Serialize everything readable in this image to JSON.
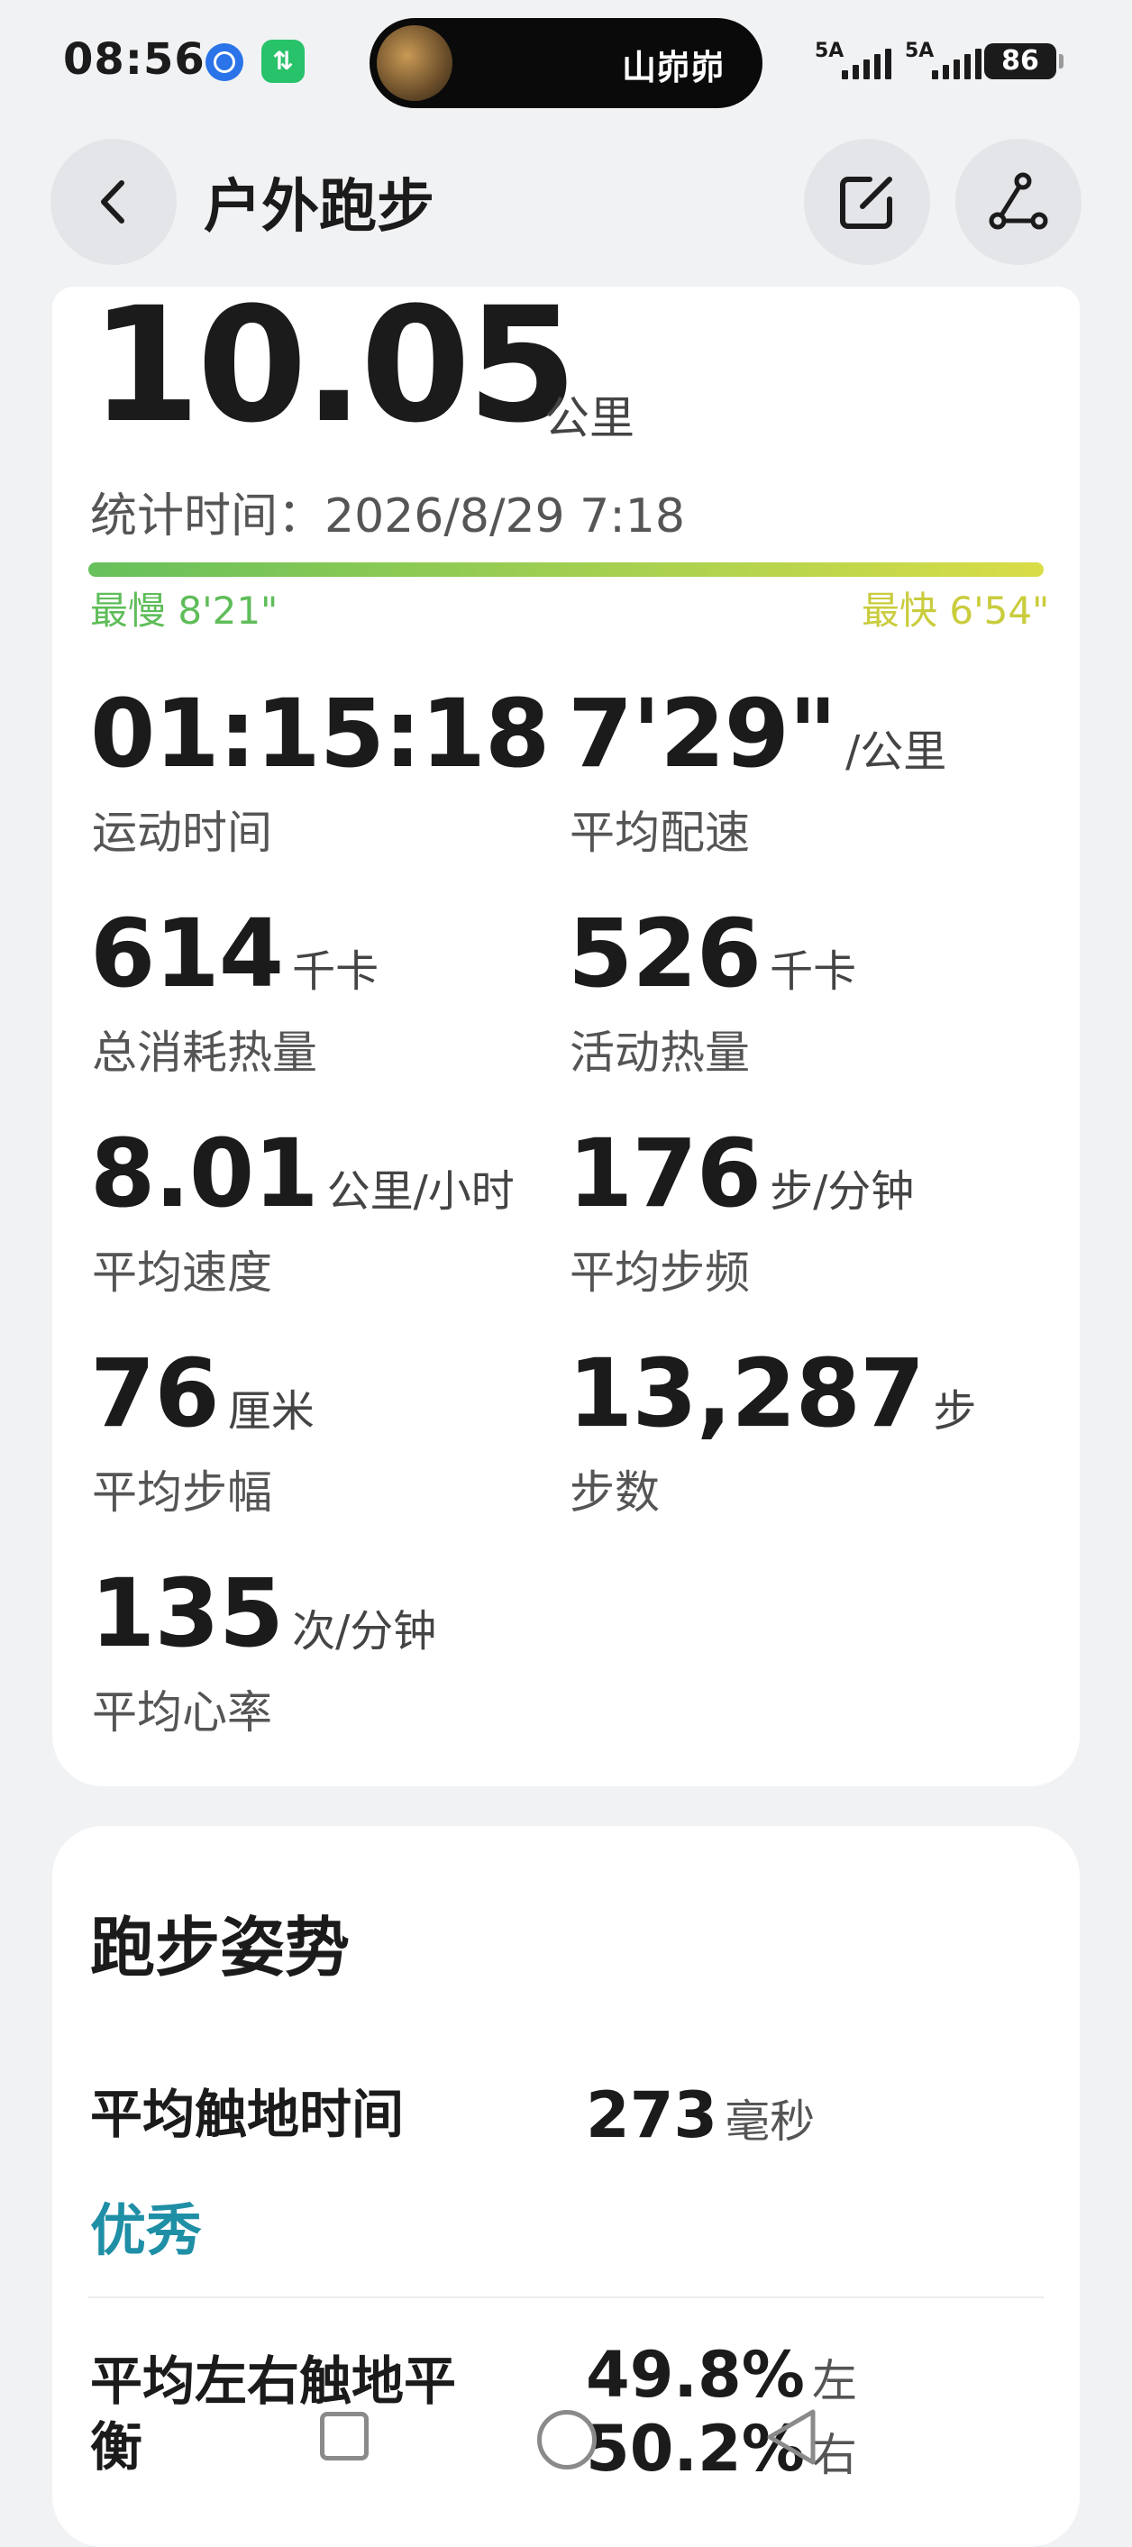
{
  "status_bar": {
    "time": "08:56",
    "island_name": "山峁峁",
    "signal_1": "5A",
    "signal_2": "5A",
    "battery": "86",
    "icons": [
      "browser-icon",
      "app-icon",
      "avatar",
      "signal-icon",
      "battery-icon"
    ]
  },
  "header": {
    "title": "户外跑步",
    "back_icon": "chevron-left-icon",
    "edit_icon": "edit-icon",
    "share_icon": "share-icon"
  },
  "summary": {
    "distance": "10.05",
    "distance_unit": "公里",
    "stat_time": "统计时间：2026/8/29 7:18",
    "slowest": "最慢 8'21\"",
    "fastest": "最快 6'54\"",
    "pace_bar_colors": [
      "#66c05b",
      "#d9dd47"
    ]
  },
  "metrics": [
    {
      "value": "01:15:18",
      "unit": "",
      "label": "运动时间"
    },
    {
      "value": "7'29\"",
      "unit": "/公里",
      "label": "平均配速"
    },
    {
      "value": "614",
      "unit": "千卡",
      "label": "总消耗热量"
    },
    {
      "value": "526",
      "unit": "千卡",
      "label": "活动热量"
    },
    {
      "value": "8.01",
      "unit": "公里/小时",
      "label": "平均速度"
    },
    {
      "value": "176",
      "unit": "步/分钟",
      "label": "平均步频"
    },
    {
      "value": "76",
      "unit": "厘米",
      "label": "平均步幅"
    },
    {
      "value": "13,287",
      "unit": "步",
      "label": "步数"
    },
    {
      "value": "135",
      "unit": "次/分钟",
      "label": "平均心率"
    }
  ],
  "posture": {
    "title": "跑步姿势",
    "contact_time_label": "平均触地时间",
    "contact_time_value": "273",
    "contact_time_unit": "毫秒",
    "contact_time_rating": "优秀",
    "balance_label": "平均左右触地平衡",
    "balance_left_value": "49.8%",
    "balance_left_unit": "左",
    "balance_right_value": "50.2%",
    "balance_right_unit": "右",
    "accent_color": "#1f8fa6"
  },
  "nav_bar": {
    "icons": [
      "recents-icon",
      "home-icon",
      "back-icon"
    ]
  }
}
